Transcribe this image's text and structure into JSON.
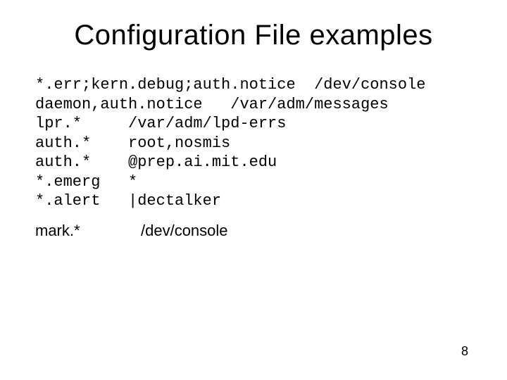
{
  "title": "Configuration File examples",
  "code": {
    "l1": "*.err;kern.debug;auth.notice  /dev/console",
    "l2": "daemon,auth.notice   /var/adm/messages",
    "l3": "lpr.*     /var/adm/lpd-errs",
    "l4": "auth.*    root,nosmis",
    "l5": "auth.*    @prep.ai.mit.edu",
    "l6": "*.emerg   *",
    "l7": "*.alert   |dectalker"
  },
  "aux": {
    "left": "mark.*",
    "right": "/dev/console"
  },
  "page_number": "8"
}
